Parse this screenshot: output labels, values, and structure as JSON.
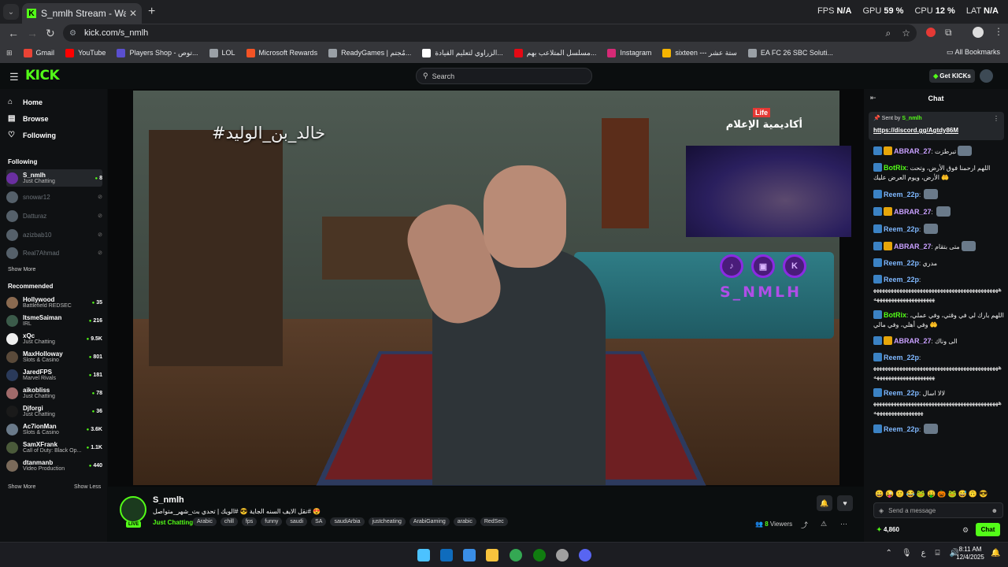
{
  "browser": {
    "tab_title": "S_nmlh Stream - Watch Live on",
    "tab_close": "✕",
    "new_tab": "+",
    "perf": {
      "fps_label": "FPS",
      "fps": "N/A",
      "gpu_label": "GPU",
      "gpu": "59 %",
      "cpu_label": "CPU",
      "cpu": "12 %",
      "lat_label": "LAT",
      "lat": "N/A"
    },
    "url": "kick.com/s_nmlh",
    "bookmarks": [
      {
        "label": "Gmail",
        "color": "#ea4335"
      },
      {
        "label": "YouTube",
        "color": "#ff0000"
      },
      {
        "label": "Players Shop - توص...",
        "color": "#5a4fcf"
      },
      {
        "label": "LOL",
        "color": "#9aa0a6"
      },
      {
        "label": "Microsoft Rewards",
        "color": "#f35325"
      },
      {
        "label": "ReadyGames | مُجتم...",
        "color": "#9aa0a6"
      },
      {
        "label": "الزراوي لتعليم القيادة...",
        "color": "#ffffff"
      },
      {
        "label": "مسلسل المتلاعب بهم...",
        "color": "#e50914"
      },
      {
        "label": "Instagram",
        "color": "#d62976"
      },
      {
        "label": "sixteen --- ستة عشر",
        "color": "#f4b400"
      },
      {
        "label": "EA FC 26 SBC Soluti...",
        "color": "#9aa0a6"
      }
    ],
    "all_bookmarks": "All Bookmarks"
  },
  "kick": {
    "logo": "KICK",
    "search_placeholder": "Search",
    "get_kicks": "Get KICKs",
    "nav": [
      {
        "label": "Home",
        "icon": "home-icon"
      },
      {
        "label": "Browse",
        "icon": "browse-icon"
      },
      {
        "label": "Following",
        "icon": "heart-icon"
      }
    ],
    "following_label": "Following",
    "following": [
      {
        "name": "S_nmlh",
        "cat": "Just Chatting",
        "viewers": "8",
        "live": true
      },
      {
        "name": "snowar12",
        "cat": "",
        "viewers": "",
        "live": false
      },
      {
        "name": "Datturaz",
        "cat": "",
        "viewers": "",
        "live": false
      },
      {
        "name": "azizbab10",
        "cat": "",
        "viewers": "",
        "live": false
      },
      {
        "name": "Real7Ahmad",
        "cat": "",
        "viewers": "",
        "live": false
      }
    ],
    "show_more_1": "Show More",
    "recommended_label": "Recommended",
    "recommended": [
      {
        "name": "Hollywood",
        "cat": "Battlefield REDSEC",
        "viewers": "35"
      },
      {
        "name": "ItsmeSaiman",
        "cat": "IRL",
        "viewers": "216"
      },
      {
        "name": "xQc",
        "cat": "Just Chatting",
        "viewers": "9.5K"
      },
      {
        "name": "MaxHolloway",
        "cat": "Slots & Casino",
        "viewers": "801"
      },
      {
        "name": "JaredFPS",
        "cat": "Marvel Rivals",
        "viewers": "181"
      },
      {
        "name": "aikobliss",
        "cat": "Just Chatting",
        "viewers": "78"
      },
      {
        "name": "Djforgi",
        "cat": "Just Chatting",
        "viewers": "36"
      },
      {
        "name": "Ac7ionMan",
        "cat": "Slots & Casino",
        "viewers": "3.6K"
      },
      {
        "name": "SamXFrank",
        "cat": "Call of Duty: Black Op...",
        "viewers": "1.1K"
      },
      {
        "name": "dtanmanb",
        "cat": "Video Production",
        "viewers": "440"
      }
    ],
    "show_more_2": "Show More",
    "show_less": "Show Less"
  },
  "stream": {
    "overlay_hashtag": "#خالد_بن_الوليد",
    "overlay_life": "Life",
    "overlay_academy": "أكاديمية الإعلام",
    "brand_text": "S_NMLH",
    "socials": [
      "♪",
      "▣",
      "K"
    ],
    "streamer": "S_nmlh",
    "live_badge": "LIVE",
    "title": "نقل الايف السنه الجاية 😎 #الويك | تحدي بث_شهر_متواصل# 😍",
    "category": "Just Chatting",
    "tags": [
      "Arabic",
      "chill",
      "fps",
      "funny",
      "saudi",
      "SA",
      "saudiArbia",
      "justcheating",
      "ArabiGaming",
      "arabic",
      "RedSec"
    ],
    "viewers_count": "8",
    "viewers_label": "Viewers"
  },
  "chat": {
    "title": "Chat",
    "pinned_sent_by": "Sent by",
    "pinned_user": "S_nmlh",
    "pinned_link": "https://discord.gg/Agtdy86M",
    "messages": [
      {
        "user": "ABRAR_27",
        "color": "#c9a0ff",
        "text": "تبرطزت",
        "emote": true,
        "bot": false
      },
      {
        "user": "BotRix",
        "color": "#53fc18",
        "text": "اللهم ارحمنا فوق الأرض، وتحت الأرض، ويوم العرض عليك 🤲",
        "emote": false,
        "bot": true
      },
      {
        "user": "Reem_22p",
        "color": "#7fb8ff",
        "text": "",
        "emote": true,
        "bot": false
      },
      {
        "user": "ABRAR_27",
        "color": "#c9a0ff",
        "text": "",
        "emote": true,
        "bot": false
      },
      {
        "user": "Reem_22p",
        "color": "#7fb8ff",
        "text": "",
        "emote": true,
        "bot": false
      },
      {
        "user": "ABRAR_27",
        "color": "#c9a0ff",
        "text": "متى بتقام",
        "emote": true,
        "bot": false
      },
      {
        "user": "Reem_22p",
        "color": "#7fb8ff",
        "text": "مدري",
        "emote": false,
        "bot": false
      },
      {
        "user": "Reem_22p",
        "color": "#7fb8ff",
        "text": "ههههههههههههههههههههههههههههههههههههههههههههههههههههههههههههههههه",
        "emote": false,
        "bot": false
      },
      {
        "user": "BotRix",
        "color": "#53fc18",
        "text": "اللهم بارك لي في وقتي، وفي عملي، وفي أهلي، وفي مالي 🤲",
        "emote": false,
        "bot": true
      },
      {
        "user": "ABRAR_27",
        "color": "#c9a0ff",
        "text": "الى وناك",
        "emote": false,
        "bot": false
      },
      {
        "user": "Reem_22p",
        "color": "#7fb8ff",
        "text": "ههههههههههههههههههههههههههههههههههههههههههههههههههههههههههههههههه",
        "emote": false,
        "bot": false
      },
      {
        "user": "Reem_22p",
        "color": "#7fb8ff",
        "text": "لالا اسال ههههههههههههههههههههههههههههههههههههههههههههههههههههههههههههه",
        "emote": false,
        "bot": false
      },
      {
        "user": "Reem_22p",
        "color": "#7fb8ff",
        "text": "",
        "emote": true,
        "bot": false
      }
    ],
    "send_placeholder": "Send a message",
    "points": "4,860",
    "chat_button": "Chat"
  },
  "taskbar": {
    "clock_time": "8:11 AM",
    "clock_date": "12/4/2025",
    "apps": [
      {
        "name": "windows-start-icon",
        "color": "#4cc2ff"
      },
      {
        "name": "outlook-icon",
        "color": "#0f6cbd"
      },
      {
        "name": "store-icon",
        "color": "#3a8ee6"
      },
      {
        "name": "explorer-icon",
        "color": "#f8c33d"
      },
      {
        "name": "chrome-icon",
        "color": "#34a853"
      },
      {
        "name": "xbox-icon",
        "color": "#107c10"
      },
      {
        "name": "obs-icon",
        "color": "#a0a0a0"
      },
      {
        "name": "discord-icon",
        "color": "#5865f2"
      }
    ]
  }
}
